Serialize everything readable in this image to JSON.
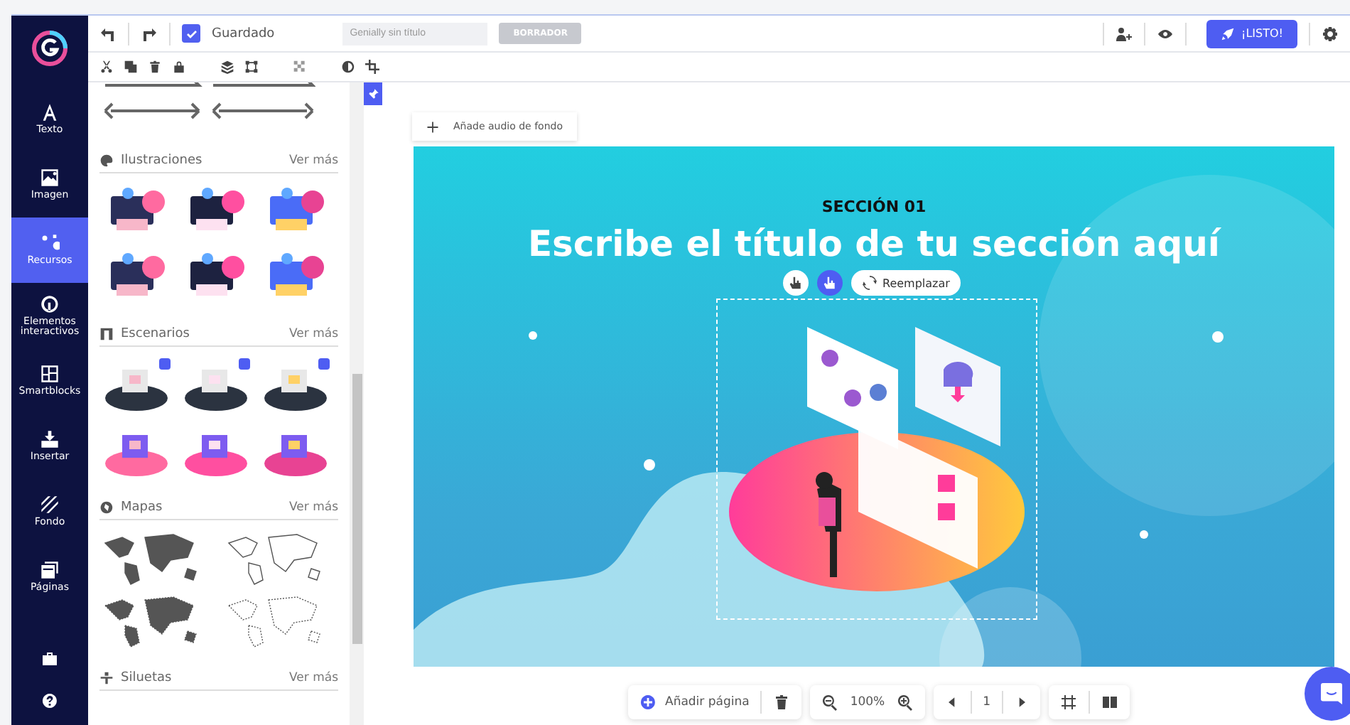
{
  "nav": {
    "items": [
      {
        "label": "Texto",
        "kind": "text",
        "selected": false
      },
      {
        "label": "Imagen",
        "kind": "image",
        "selected": false
      },
      {
        "label": "Recursos",
        "kind": "resources",
        "selected": true
      },
      {
        "label": "Elementos interactivos",
        "kind": "interactive",
        "selected": false
      },
      {
        "label": "Smartblocks",
        "kind": "smartblocks",
        "selected": false
      },
      {
        "label": "Insertar",
        "kind": "insert",
        "selected": false
      },
      {
        "label": "Fondo",
        "kind": "background",
        "selected": false
      },
      {
        "label": "Páginas",
        "kind": "pages",
        "selected": false
      }
    ]
  },
  "toolbar": {
    "saved": {
      "label": "Guardado",
      "checked": true
    },
    "title_field": {
      "placeholder": "Genially sin título"
    },
    "status_badge": "BORRADOR",
    "publish_button": "¡LISTO!"
  },
  "panel": {
    "sections": [
      {
        "title": "Ilustraciones",
        "kind": "illustrations",
        "more": "Ver más"
      },
      {
        "title": "Escenarios",
        "kind": "scenarios",
        "more": "Ver más"
      },
      {
        "title": "Mapas",
        "kind": "maps",
        "more": "Ver más"
      },
      {
        "title": "Siluetas",
        "kind": "silhouettes",
        "more": "Ver más"
      }
    ]
  },
  "canvas": {
    "audio_button": "Añade audio de fondo",
    "section_label": "SECCIÓN 01",
    "title": "Escribe el título de tu sección aquí",
    "replace_button": "Reemplazar"
  },
  "bottom_bar": {
    "add_page": "Añadir página",
    "zoom": "100%",
    "page": "1"
  }
}
